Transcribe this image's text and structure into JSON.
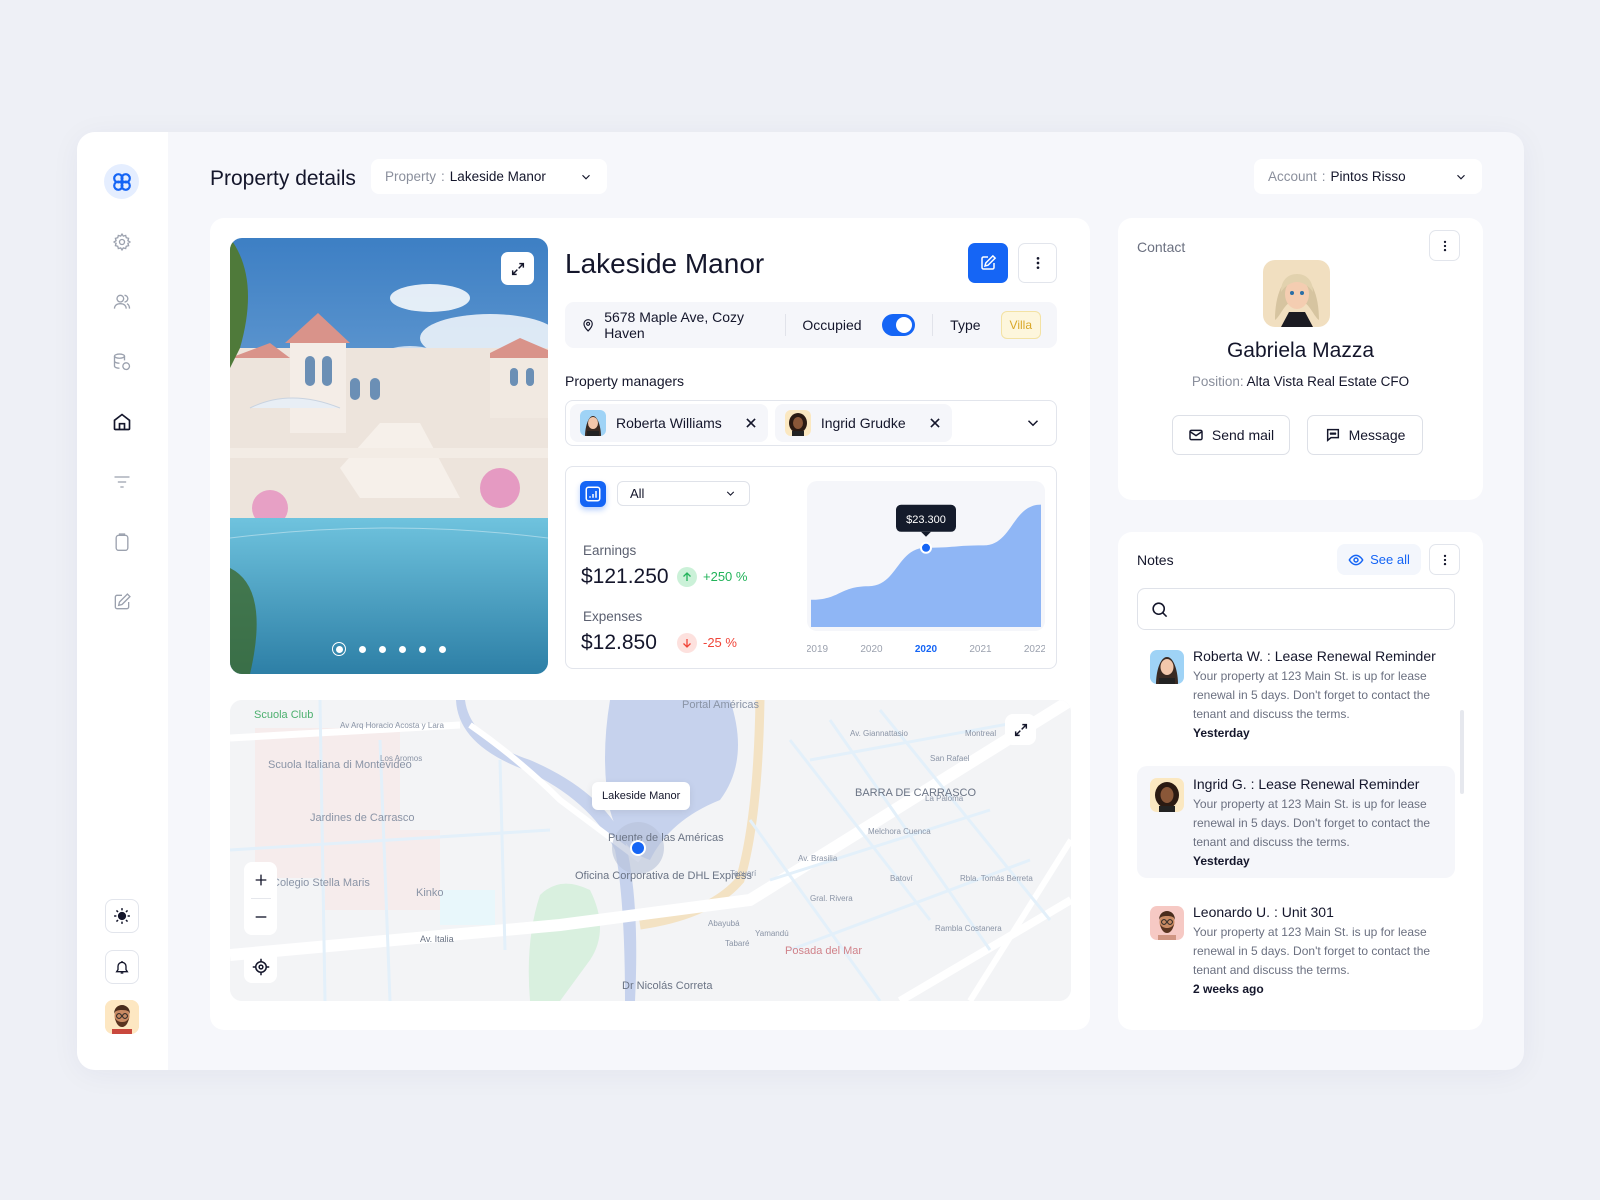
{
  "header": {
    "title": "Property details",
    "property_selector": {
      "label": "Property",
      "value": "Lakeside Manor"
    },
    "account_selector": {
      "label": "Account",
      "value": "Pintos Risso"
    }
  },
  "sidebar": {
    "items": [
      {
        "icon": "gear-icon",
        "label": "Settings"
      },
      {
        "icon": "users-icon",
        "label": "Users"
      },
      {
        "icon": "database-icon",
        "label": "Data"
      },
      {
        "icon": "home-icon",
        "label": "Home",
        "active": true
      },
      {
        "icon": "filter-icon",
        "label": "Filter"
      },
      {
        "icon": "clipboard-icon",
        "label": "Clipboard"
      },
      {
        "icon": "edit-icon",
        "label": "Edit"
      }
    ],
    "bottom": [
      "sun-icon",
      "bell-icon",
      "user-avatar"
    ]
  },
  "property": {
    "name": "Lakeside Manor",
    "address": "5678 Maple Ave, Cozy Haven",
    "occupied_label": "Occupied",
    "occupied": true,
    "type_label": "Type",
    "type_value": "Villa",
    "gallery": {
      "count": 6,
      "active_index": 0
    },
    "managers_label": "Property managers",
    "managers": [
      {
        "name": "Roberta Williams"
      },
      {
        "name": "Ingrid Grudke"
      }
    ]
  },
  "stats": {
    "filter_value": "All",
    "earnings": {
      "label": "Earnings",
      "value": "$121.250",
      "change": "+250 %",
      "direction": "up"
    },
    "expenses": {
      "label": "Expenses",
      "value": "$12.850",
      "change": "-25 %",
      "direction": "down"
    }
  },
  "chart_data": {
    "type": "area",
    "x": [
      "2019",
      "2020",
      "2020",
      "2021",
      "2022"
    ],
    "highlight_index": 2,
    "tooltip": "$23.300",
    "series": [
      {
        "name": "Earnings",
        "values": [
          8,
          12,
          23.3,
          24,
          36
        ]
      }
    ],
    "ylim": [
      0,
      40
    ],
    "color": "#8fb6f5"
  },
  "map": {
    "pin_label": "Lakeside Manor",
    "labels": [
      "Scuola Club",
      "Av Arq Horacio Acosta y Lara",
      "Scuola Italiana di Montevideo",
      "Los Aromos",
      "Jardines de Carrasco",
      "Portal Américas",
      "Av. Giannattasio",
      "San Rafael",
      "Montreal",
      "BARRA DE CARRASCO",
      "La Paloma",
      "Melchora Cuenca",
      "Puente de las Américas",
      "Oficina Corporativa de DHL Express",
      "Colegio Stella Maris",
      "Kinko",
      "Av. Italia",
      "Av. Brasilia",
      "Tacuarí",
      "Gral. Rivera",
      "Batoví",
      "Rbla. Tomás Berreta",
      "Rambla Costanera",
      "Posada del Mar",
      "Abayubá",
      "Tabaré",
      "Yamandú",
      "Dr Nicolás Correta"
    ]
  },
  "contact": {
    "title": "Contact",
    "name": "Gabriela Mazza",
    "position_label": "Position:",
    "position_value": "Alta Vista Real Estate CFO",
    "send_mail": "Send mail",
    "message": "Message"
  },
  "notes": {
    "title": "Notes",
    "see_all": "See all",
    "search_placeholder": "",
    "items": [
      {
        "title": "Roberta W. : Lease Renewal Reminder",
        "body": "Your property at 123 Main St. is up for lease renewal in 5 days. Don't forget to contact the tenant and discuss the terms.",
        "time": "Yesterday"
      },
      {
        "title": "Ingrid G. : Lease Renewal Reminder",
        "body": "Your property at 123 Main St. is up for lease renewal in 5 days. Don't forget to contact the tenant and discuss the terms.",
        "time": "Yesterday"
      },
      {
        "title": "Leonardo U. : Unit 301",
        "body": "Your property at 123 Main St. is up for lease renewal in 5 days. Don't forget to contact the tenant and discuss the terms.",
        "time": "2 weeks ago"
      }
    ]
  },
  "colors": {
    "accent": "#1565f5",
    "up": "#22b35a",
    "down": "#f04438",
    "villa": "#d9a728"
  }
}
